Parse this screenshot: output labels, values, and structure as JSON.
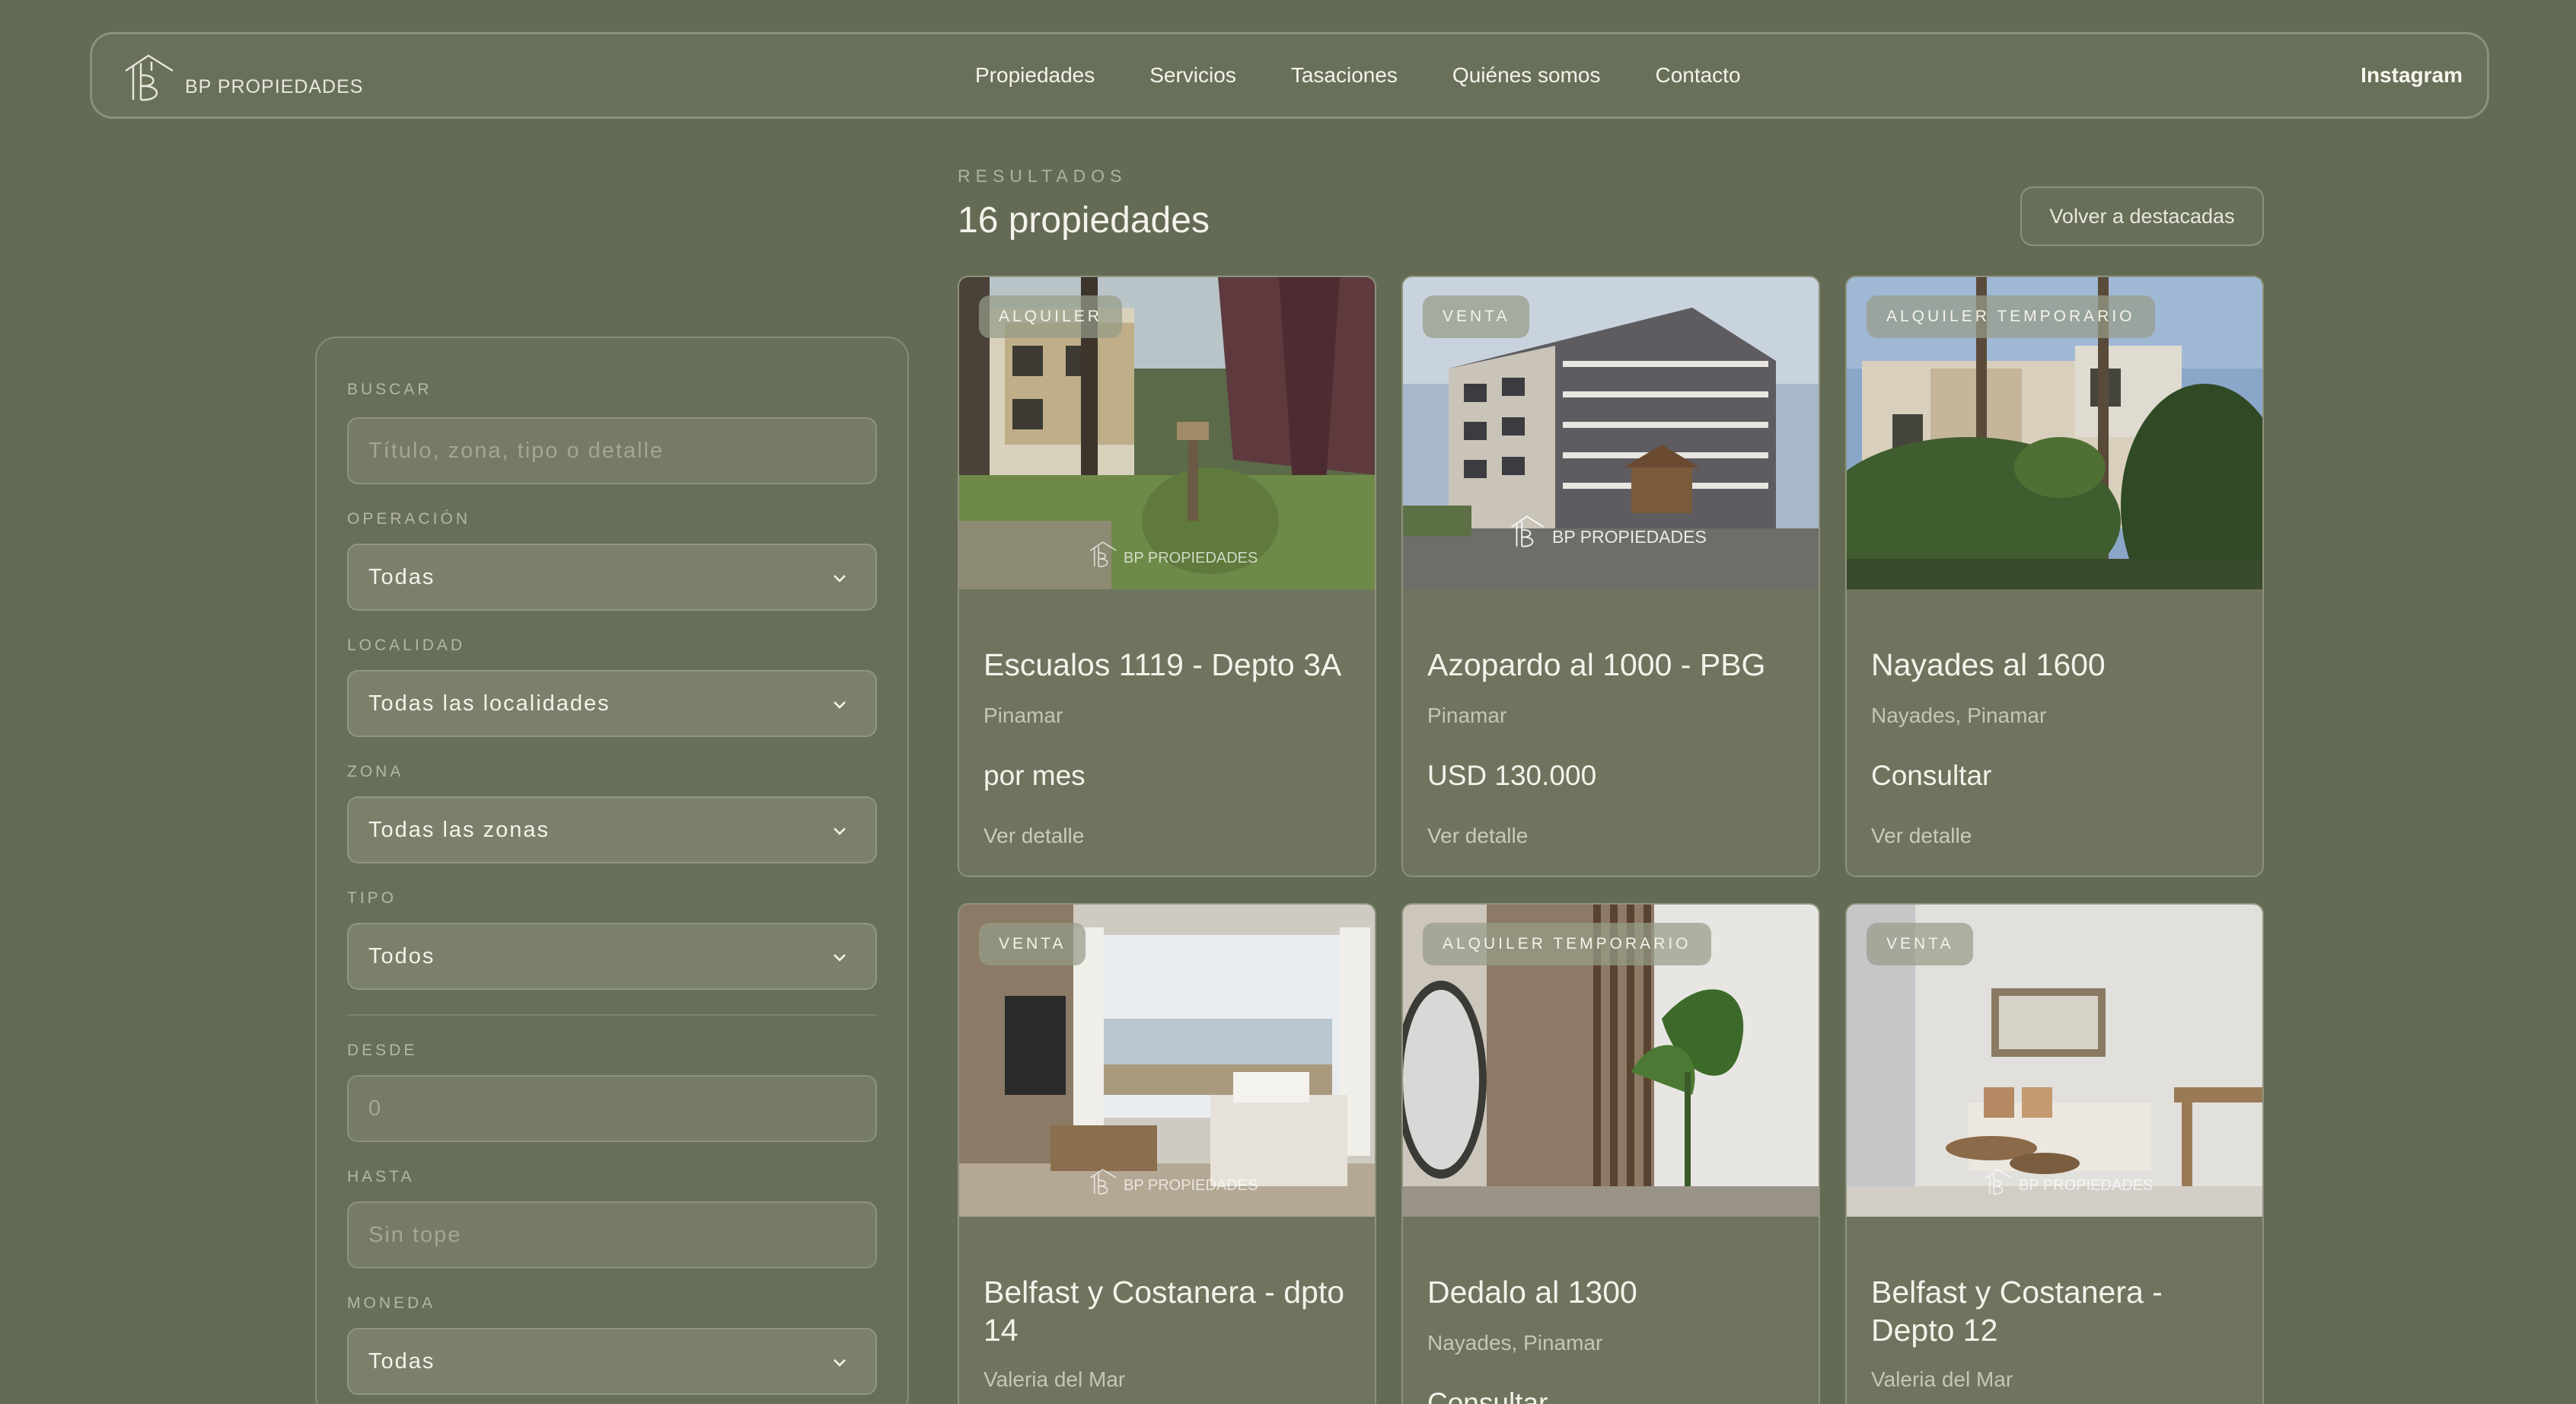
{
  "header": {
    "logo_text": "BP PROPIEDADES",
    "nav": [
      "Propiedades",
      "Servicios",
      "Tasaciones",
      "Quiénes somos",
      "Contacto"
    ],
    "instagram": "Instagram"
  },
  "results": {
    "label": "RESULTADOS",
    "count": "16 propiedades",
    "back_button": "Volver a destacadas"
  },
  "filters": {
    "search": {
      "label": "BUSCAR",
      "placeholder": "Título, zona, tipo o detalle"
    },
    "operacion": {
      "label": "OPERACIÓN",
      "value": "Todas"
    },
    "localidad": {
      "label": "LOCALIDAD",
      "value": "Todas las localidades"
    },
    "zona": {
      "label": "ZONA",
      "value": "Todas las zonas"
    },
    "tipo": {
      "label": "TIPO",
      "value": "Todos"
    },
    "desde": {
      "label": "DESDE",
      "placeholder": "0"
    },
    "hasta": {
      "label": "HASTA",
      "placeholder": "Sin tope"
    },
    "moneda": {
      "label": "MONEDA",
      "value": "Todas"
    }
  },
  "watermark": "BP PROPIEDADES",
  "cards": [
    {
      "badge": "ALQUILER",
      "title": "Escualos 1119 - Depto 3A",
      "location": "Pinamar",
      "price": "por mes",
      "detail": "Ver detalle"
    },
    {
      "badge": "VENTA",
      "title": "Azopardo al 1000 - PBG",
      "location": "Pinamar",
      "price": "USD 130.000",
      "detail": "Ver detalle"
    },
    {
      "badge": "ALQUILER TEMPORARIO",
      "title": "Nayades al 1600",
      "location": "Nayades, Pinamar",
      "price": "Consultar",
      "detail": "Ver detalle"
    },
    {
      "badge": "VENTA",
      "title": "Belfast y Costanera - dpto 14",
      "location": "Valeria del Mar"
    },
    {
      "badge": "ALQUILER TEMPORARIO",
      "title": "Dedalo al 1300",
      "location": "Nayades, Pinamar",
      "price": "Consultar"
    },
    {
      "badge": "VENTA",
      "title": "Belfast y Costanera - Depto 12",
      "location": "Valeria del Mar"
    }
  ]
}
